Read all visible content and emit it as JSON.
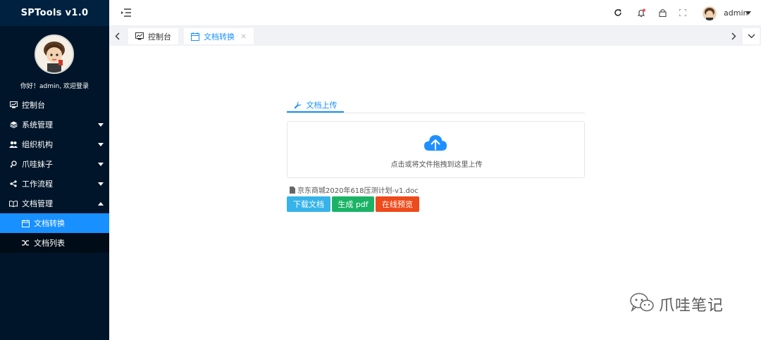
{
  "app": {
    "title": "SPTools v1.0"
  },
  "profile": {
    "welcome": "你好！admin, 欢迎登录"
  },
  "sidebar": {
    "items": [
      {
        "label": "控制台",
        "icon": "dashboard-icon"
      },
      {
        "label": "系统管理",
        "icon": "layers-icon"
      },
      {
        "label": "组织机构",
        "icon": "users-icon"
      },
      {
        "label": "爪哇妹子",
        "icon": "female-icon"
      },
      {
        "label": "工作流程",
        "icon": "share-icon"
      },
      {
        "label": "文档管理",
        "icon": "book-icon"
      }
    ],
    "subitems": [
      {
        "label": "文档转换",
        "icon": "calendar-icon"
      },
      {
        "label": "文档列表",
        "icon": "shuffle-icon"
      }
    ]
  },
  "header": {
    "user_name": "admin"
  },
  "tabs": [
    {
      "label": "控制台"
    },
    {
      "label": "文档转换",
      "close": "×"
    }
  ],
  "upload": {
    "tab_label": "文档上传",
    "drop_text": "点击或将文件拖拽到这里上传",
    "file_name": "京东商城2020年618压测计划-v1.doc"
  },
  "buttons": {
    "download": "下载文档",
    "pdf": "生成 pdf",
    "preview": "在线预览"
  },
  "watermark": {
    "text": "爪哇笔记"
  },
  "colors": {
    "sidebar_bg": "#001529",
    "active_blue": "#1890ff",
    "download_btn": "#36b3e8",
    "pdf_btn": "#1ab366",
    "preview_btn": "#ee4a1b"
  }
}
